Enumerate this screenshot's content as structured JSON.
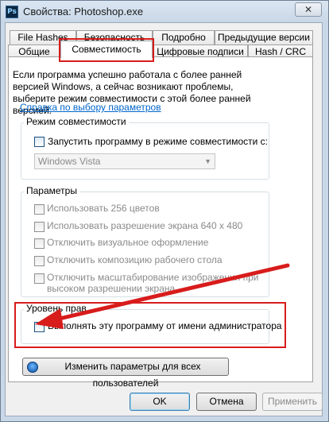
{
  "window": {
    "title": "Свойства: Photoshop.exe",
    "app_icon_text": "Ps",
    "close_glyph": "✕"
  },
  "tabs_row1": [
    {
      "label": "File Hashes"
    },
    {
      "label": "Безопасность"
    },
    {
      "label": "Подробно"
    },
    {
      "label": "Предыдущие версии"
    }
  ],
  "tabs_row2": [
    {
      "label": "Общие"
    },
    {
      "label": "Совместимость",
      "active": true
    },
    {
      "label": "Цифровые подписи"
    },
    {
      "label": "Hash / CRC"
    }
  ],
  "compat": {
    "intro": "Если программа успешно работала с более ранней версией Windows, а сейчас возникают проблемы, выберите режим совместимости с этой более ранней версией.",
    "help_link": "Справка по выбору параметров",
    "mode_group": {
      "label": "Режим совместимости",
      "checkbox": "Запустить программу в режиме совместимости с:",
      "select_value": "Windows Vista",
      "select_arrow": "▼"
    },
    "params_group": {
      "label": "Параметры",
      "options": [
        "Использовать 256 цветов",
        "Использовать разрешение экрана 640 x 480",
        "Отключить визуальное оформление",
        "Отключить композицию рабочего стола",
        "Отключить масштабирование изображения при",
        "высоком разрешении экрана"
      ]
    },
    "privilege_group": {
      "label": "Уровень прав",
      "checkbox": "Выполнять эту программу от имени администратора"
    },
    "all_users_button": "Изменить параметры для всех пользователей"
  },
  "buttons": {
    "ok": "OK",
    "cancel": "Отмена",
    "apply": "Применить"
  },
  "colors": {
    "highlight": "#d81c1c",
    "link": "#0066cc"
  }
}
